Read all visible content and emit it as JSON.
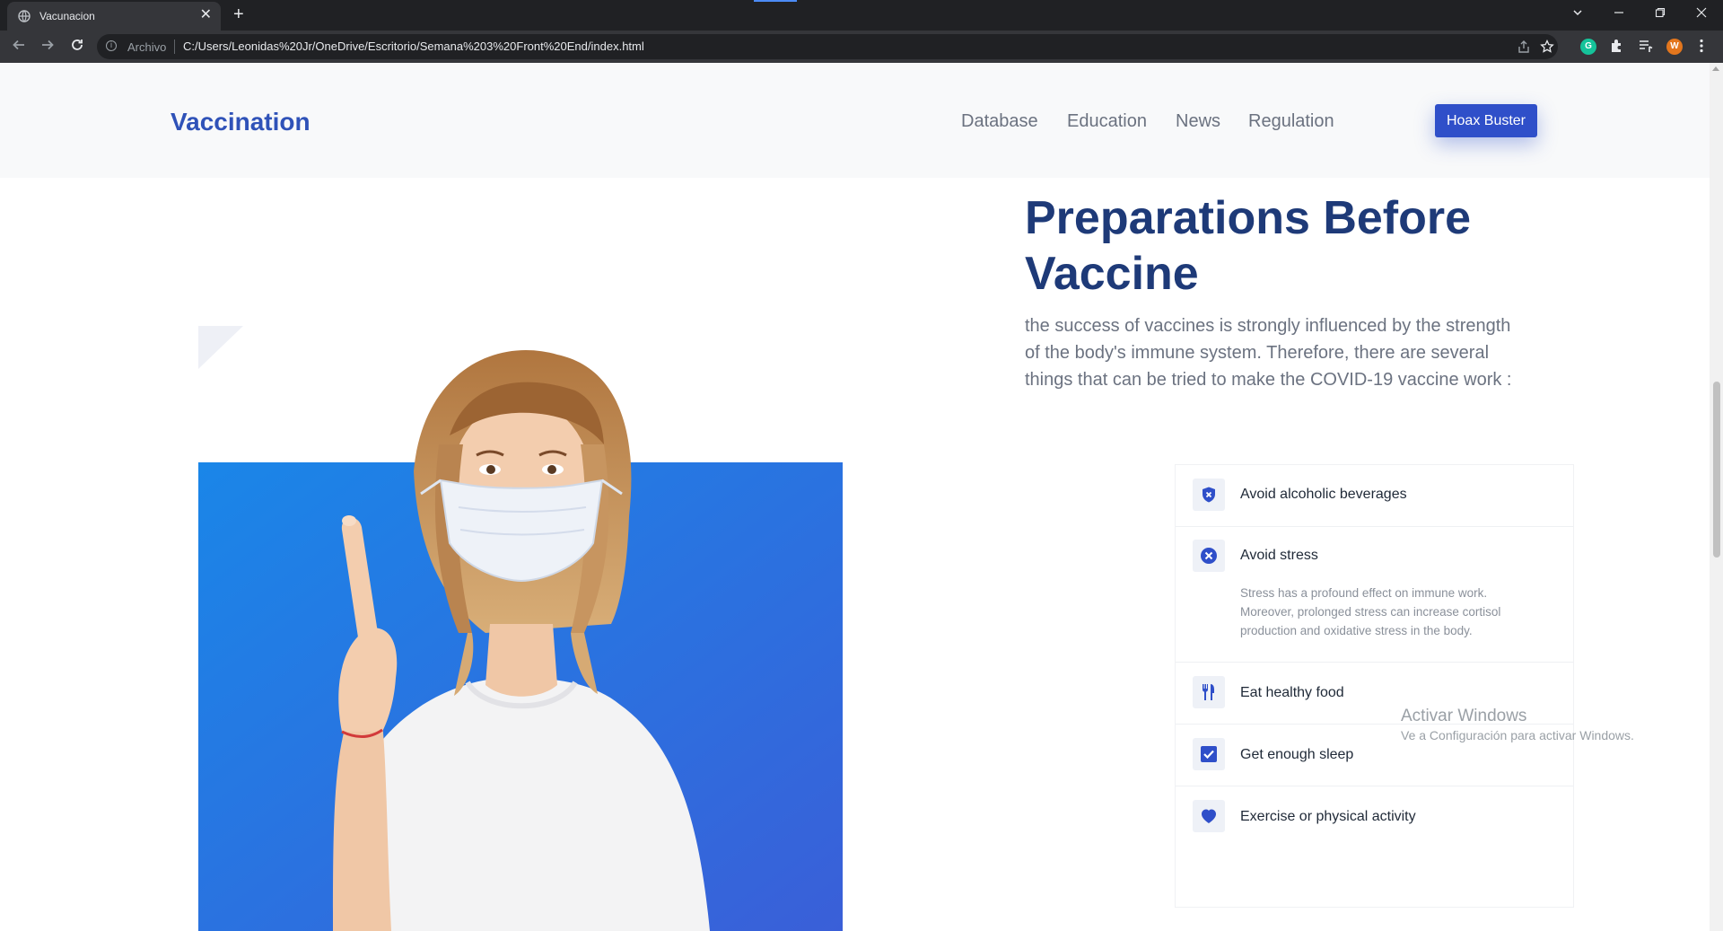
{
  "browser": {
    "tab_title": "Vacunacion",
    "tab_close_glyph": "✕",
    "new_tab_glyph": "+",
    "address_label": "Archivo",
    "url": "C:/Users/Leonidas%20Jr/OneDrive/Escritorio/Semana%203%20Front%20End/index.html",
    "extension_g_letter": "G",
    "profile_initial": "W",
    "icons": [
      "back-arrow-icon",
      "forward-arrow-icon",
      "reload-icon",
      "info-icon",
      "share-icon",
      "star-icon",
      "extension-g-icon",
      "puzzle-icon",
      "reading-list-icon",
      "profile-avatar",
      "kebab-menu-icon",
      "tab-search-icon",
      "minimize-icon",
      "restore-icon",
      "close-icon"
    ]
  },
  "header": {
    "brand": "Vaccination",
    "nav": [
      "Database",
      "Education",
      "News",
      "Regulation"
    ],
    "cta_label": "Hoax Buster"
  },
  "hero": {
    "title": "Preparations Before Vaccine",
    "description": "the success of vaccines is strongly influenced by the strength of the body's immune system. Therefore, there are several things that can be tried to make the COVID-19 vaccine work :"
  },
  "checklist": [
    {
      "label": "Avoid alcoholic beverages",
      "icon": "shield-x-icon"
    },
    {
      "label": "Avoid stress",
      "icon": "circle-x-icon",
      "detail": "Stress has a profound effect on immune work. Moreover, prolonged stress can increase cortisol production and oxidative stress in the body."
    },
    {
      "label": "Eat healthy food",
      "icon": "utensils-icon"
    },
    {
      "label": "Get enough sleep",
      "icon": "checkbox-icon"
    },
    {
      "label": "Exercise or physical activity",
      "icon": "heart-icon"
    }
  ],
  "windows_watermark": {
    "line1": "Activar Windows",
    "line2": "Ve a Configuración para activar Windows."
  },
  "colors": {
    "brand_blue": "#2f52b8",
    "cta_blue": "#2f4fc9",
    "title_navy": "#1e3a78",
    "photo_bg": "#1f7ae0"
  }
}
